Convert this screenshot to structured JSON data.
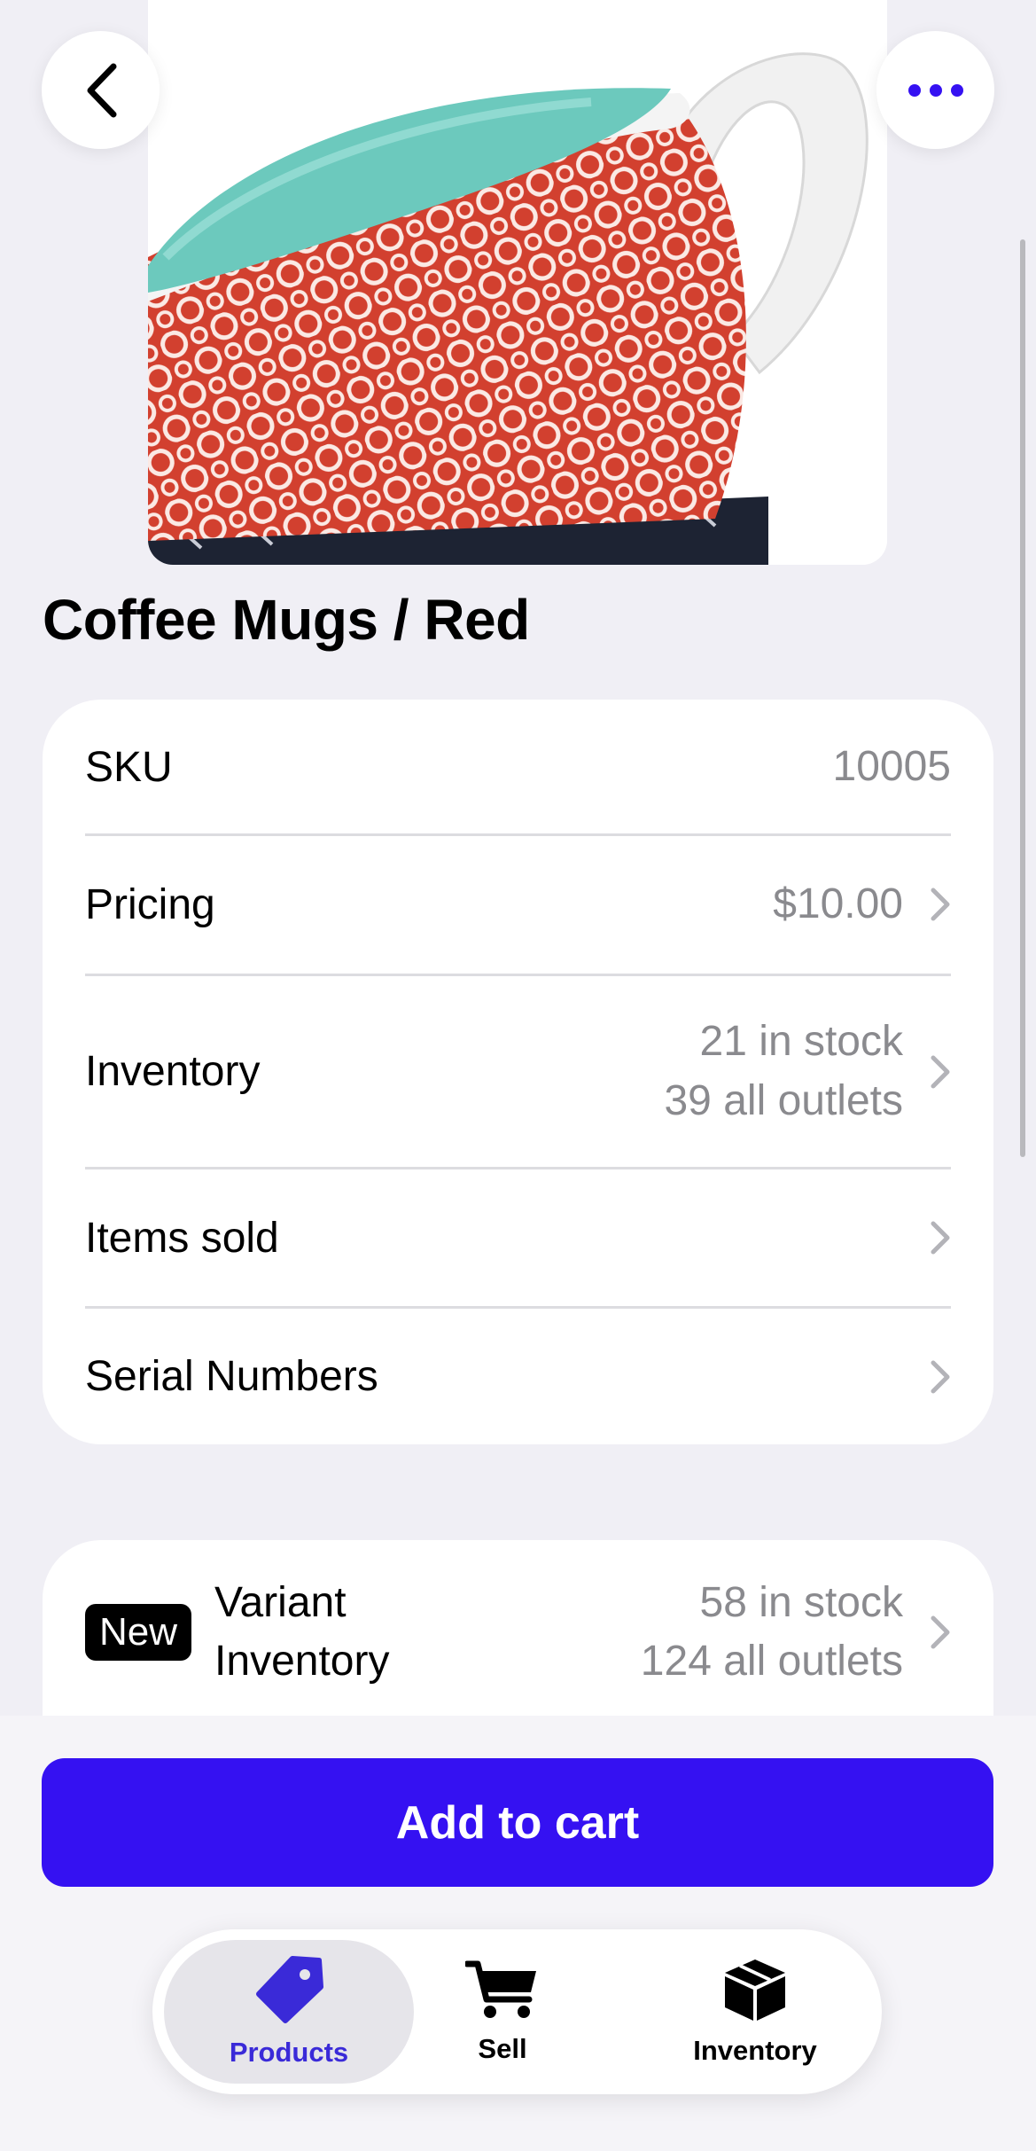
{
  "nav": {
    "back_icon": "chevron-left-icon",
    "more_icon": "ellipsis-icon",
    "accent": "#3511f2"
  },
  "product": {
    "title": "Coffee Mugs / Red",
    "image": "red-patterned-mug-with-teal-interior"
  },
  "details": {
    "sku_label": "SKU",
    "sku_value": "10005",
    "pricing_label": "Pricing",
    "pricing_value": "$10.00",
    "inventory_label": "Inventory",
    "inventory_stock": "21 in stock",
    "inventory_outlets": "39 all outlets",
    "items_sold_label": "Items sold",
    "serial_numbers_label": "Serial Numbers"
  },
  "variant": {
    "badge": "New",
    "label_line1": "Variant",
    "label_line2": "Inventory",
    "stock": "58 in stock",
    "outlets": "124 all outlets"
  },
  "actions": {
    "add_to_cart": "Add to cart"
  },
  "tabbar": {
    "products": "Products",
    "sell": "Sell",
    "inventory": "Inventory",
    "active": "products"
  }
}
